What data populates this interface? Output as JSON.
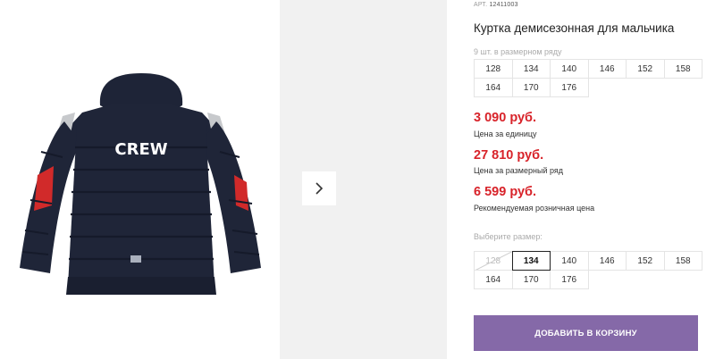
{
  "product": {
    "article_label": "АРТ.",
    "article_number": "12411003",
    "title": "Куртка демисезонная для мальчика",
    "jacket_print": "CREW"
  },
  "size_row": {
    "note": "9 шт. в размерном ряду",
    "sizes": [
      "128",
      "134",
      "140",
      "146",
      "152",
      "158",
      "164",
      "170",
      "176"
    ]
  },
  "prices": [
    {
      "amount": "3 090 руб.",
      "caption": "Цена за единицу"
    },
    {
      "amount": "27 810 руб.",
      "caption": "Цена за размерный ряд"
    },
    {
      "amount": "6 599 руб.",
      "caption": "Рекомендуемая розничная цена"
    }
  ],
  "size_picker": {
    "label": "Выберите размер:",
    "sizes": [
      "128",
      "134",
      "140",
      "146",
      "152",
      "158",
      "164",
      "170",
      "176"
    ],
    "selected": "134",
    "unavailable": [
      "128"
    ]
  },
  "cart_button": "ДОБАВИТЬ В КОРЗИНУ",
  "colors": {
    "accent_purple": "#8569a8",
    "price_red": "#d8232a",
    "jacket_navy": "#1f2538"
  },
  "icons": {
    "next": "chevron-right-icon"
  }
}
